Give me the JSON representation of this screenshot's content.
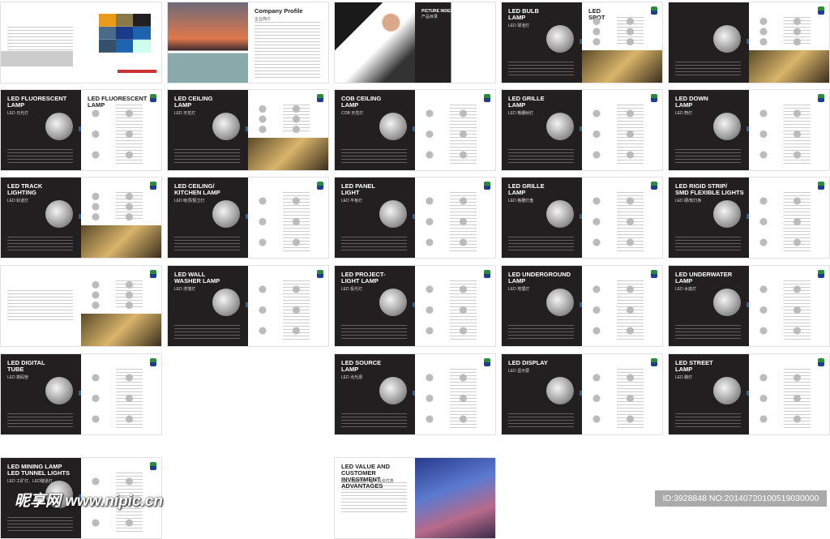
{
  "spreads": [
    {
      "row": 0,
      "col": 0,
      "title": "",
      "subtitle": "",
      "left": "light",
      "right": "cover"
    },
    {
      "row": 0,
      "col": 1,
      "title": "Company Profile",
      "subtitle": "企业简介",
      "left": "photo-sea",
      "right": "text"
    },
    {
      "row": 0,
      "col": 2,
      "title": "PICTURE INDEX",
      "subtitle": "产品目录",
      "left": "photo-chess",
      "right": "index"
    },
    {
      "row": 0,
      "col": 3,
      "title": "LED BULB\nLAMP",
      "subtitle": "LED 球泡灯",
      "left": "dark",
      "right": "products-photo",
      "title2": "LED\nSPOT"
    },
    {
      "row": 0,
      "col": 4,
      "title": "",
      "subtitle": "",
      "left": "dark",
      "right": "products-photo"
    },
    {
      "row": 1,
      "col": 0,
      "title": "LED FLUORESCENT\nLAMP",
      "subtitle": "LED 日光灯",
      "left": "dark",
      "right": "products",
      "title2": "LED FLUORESCENT\nLAMP"
    },
    {
      "row": 1,
      "col": 1,
      "title": "LED CEILING\nLAMP",
      "subtitle": "LED 天花灯",
      "left": "dark",
      "right": "products-photo"
    },
    {
      "row": 1,
      "col": 2,
      "title": "COB CEILING\nLAMP",
      "subtitle": "COB 天花灯",
      "left": "dark",
      "right": "products"
    },
    {
      "row": 1,
      "col": 3,
      "title": "LED GRILLE\nLAMP",
      "subtitle": "LED 格栅射灯",
      "left": "dark",
      "right": "products"
    },
    {
      "row": 1,
      "col": 4,
      "title": "LED DOWN\nLAMP",
      "subtitle": "LED 筒灯",
      "left": "dark",
      "right": "products"
    },
    {
      "row": 2,
      "col": 0,
      "title": "LED TRACK\nLIGHTING",
      "subtitle": "LED 轨道灯",
      "left": "dark",
      "right": "products-photo"
    },
    {
      "row": 2,
      "col": 1,
      "title": "LED CEILING/\nKITCHEN LAMP",
      "subtitle": "LED 吸顶/厨卫灯",
      "left": "dark",
      "right": "products"
    },
    {
      "row": 2,
      "col": 2,
      "title": "LED PANEL\nLIGHT",
      "subtitle": "LED 平板灯",
      "left": "dark",
      "right": "products"
    },
    {
      "row": 2,
      "col": 3,
      "title": "LED GRILLE\nLAMP",
      "subtitle": "LED 格栅灯盘",
      "left": "dark",
      "right": "products"
    },
    {
      "row": 2,
      "col": 4,
      "title": "LED RIGID STRIP/\nSMD FLEXIBLE LIGHTS",
      "subtitle": "LED 硬/软灯条",
      "left": "dark",
      "right": "products"
    },
    {
      "row": 3,
      "col": 0,
      "title": "",
      "subtitle": "",
      "left": "light",
      "right": "products-photo"
    },
    {
      "row": 3,
      "col": 1,
      "title": "LED WALL\nWASHER LAMP",
      "subtitle": "LED 洗墙灯",
      "left": "dark",
      "right": "products"
    },
    {
      "row": 3,
      "col": 2,
      "title": "LED PROJECT-\nLIGHT LAMP",
      "subtitle": "LED 投光灯",
      "left": "dark",
      "right": "products"
    },
    {
      "row": 3,
      "col": 3,
      "title": "LED UNDERGROUND\nLAMP",
      "subtitle": "LED 地埋灯",
      "left": "dark",
      "right": "products"
    },
    {
      "row": 3,
      "col": 4,
      "title": "LED UNDERWATER\nLAMP",
      "subtitle": "LED 水底灯",
      "left": "dark",
      "right": "products"
    },
    {
      "row": 4,
      "col": 0,
      "title": "LED DIGITAL\nTUBE",
      "subtitle": "LED 数码管",
      "left": "dark",
      "right": "products"
    },
    {
      "row": 4,
      "col": 2,
      "title": "LED SOURCE\nLAMP",
      "subtitle": "LED 点光源",
      "left": "dark",
      "right": "products"
    },
    {
      "row": 4,
      "col": 3,
      "title": "LED DISPLAY",
      "subtitle": "LED 显示屏",
      "left": "dark",
      "right": "products"
    },
    {
      "row": 4,
      "col": 4,
      "title": "LED STREET\nLAMP",
      "subtitle": "LED 路灯",
      "left": "dark",
      "right": "products"
    },
    {
      "row": 5,
      "col": 0,
      "title": "LED MINING LAMP\nLED TUNNEL LIGHTS",
      "subtitle": "LED 工矿灯、LED隧道灯",
      "left": "dark",
      "right": "products"
    },
    {
      "row": 5,
      "col": 2,
      "title": "LED VALUE AND CUSTOMER\nINVESTMENT ADVANTAGES",
      "subtitle": "LED价值优势、客户投资优势",
      "left": "light",
      "right": "photo-building"
    }
  ],
  "watermark": {
    "site": "昵享网 www.nipic.cn",
    "id": "ID:3928848 NO:20140720100519030000"
  }
}
